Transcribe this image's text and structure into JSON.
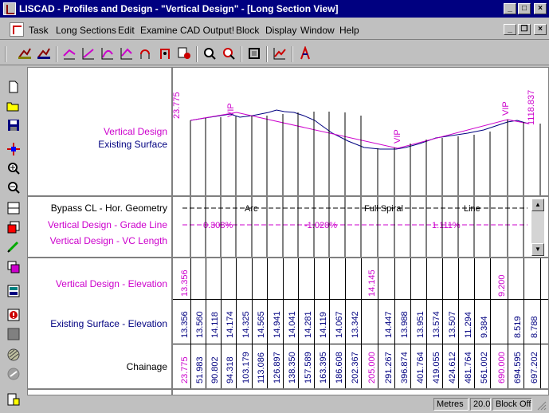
{
  "window": {
    "title": "LISCAD - Profiles and Design - \"Vertical Design\" - [Long Section View]"
  },
  "window_buttons": {
    "minimize": "_",
    "maximize": "□",
    "close": "×"
  },
  "mdi_buttons": {
    "minimize": "_",
    "restore": "❐",
    "close": "×"
  },
  "menu": [
    "Task",
    "Long Sections",
    "Edit",
    "Examine",
    "CAD Output!",
    "Block",
    "Display",
    "Window",
    "Help"
  ],
  "toolbar_icons": [
    "open-section-icon",
    "import-section-icon",
    "edit-design-icon",
    "grade-line-icon",
    "vertical-curve-icon",
    "intersection-icon",
    "design-check-icon",
    "attach-icon",
    "zoom-window-icon",
    "zoom-extents-icon",
    "frame-icon",
    "graph-icon",
    "report-icon"
  ],
  "left_toolbar_icons": [
    "new-file-icon",
    "open-folder-icon",
    "save-icon",
    "move-cross-icon",
    "zoom-in-icon",
    "zoom-out-icon",
    "split-view-icon",
    "color-icon",
    "pencil-icon",
    "copy-icon",
    "calculator-icon",
    "alert-icon",
    "block-icon",
    "hatch-icon",
    "disabled-tool-icon",
    "properties-icon"
  ],
  "labels": {
    "vertical_design": "Vertical Design",
    "existing_surface": "Existing Surface",
    "bypass": "Bypass CL - Hor. Geometry",
    "grade_line": "Vertical Design - Grade Line",
    "vc_length": "Vertical Design - VC Length",
    "vd_elevation": "Vertical Design - Elevation",
    "es_elevation": "Existing Surface - Elevation",
    "chainage": "Chainage"
  },
  "profile": {
    "start_chainage": "23.775",
    "end_chainage": "1118.837",
    "vip_label": "VIP"
  },
  "geometry": {
    "arc": "Arc",
    "full_spiral": "Full Spiral",
    "line": "Line",
    "grade1": "0.308%",
    "grade2": "-1.020%",
    "grade3": "1.111%"
  },
  "vd_elevations": [
    {
      "value": "13.356",
      "color": "#cc00cc"
    },
    {
      "value": "14.145",
      "color": "#cc00cc"
    },
    {
      "value": "9.200",
      "color": "#cc00cc"
    }
  ],
  "es_elevations": [
    "13.356",
    "13.560",
    "14.118",
    "14.174",
    "14.325",
    "14.565",
    "14.941",
    "14.041",
    "14.281",
    "14.119",
    "14.067",
    "13.342",
    "14.447",
    "13.988",
    "13.951",
    "13.574",
    "13.507",
    "11.294",
    "9.384",
    "8.519",
    "8.788"
  ],
  "chainages": [
    {
      "value": "23.775",
      "color": "#cc00cc"
    },
    {
      "value": "51.983",
      "color": "#000080"
    },
    {
      "value": "90.802",
      "color": "#000080"
    },
    {
      "value": "94.318",
      "color": "#000080"
    },
    {
      "value": "103.179",
      "color": "#000080"
    },
    {
      "value": "113.086",
      "color": "#000080"
    },
    {
      "value": "126.897",
      "color": "#000080"
    },
    {
      "value": "138.350",
      "color": "#000080"
    },
    {
      "value": "157.589",
      "color": "#000080"
    },
    {
      "value": "163.395",
      "color": "#000080"
    },
    {
      "value": "186.608",
      "color": "#000080"
    },
    {
      "value": "202.367",
      "color": "#000080"
    },
    {
      "value": "205.000",
      "color": "#cc00cc"
    },
    {
      "value": "291.267",
      "color": "#000080"
    },
    {
      "value": "396.874",
      "color": "#000080"
    },
    {
      "value": "401.764",
      "color": "#000080"
    },
    {
      "value": "419.055",
      "color": "#000080"
    },
    {
      "value": "424.612",
      "color": "#000080"
    },
    {
      "value": "481.764",
      "color": "#000080"
    },
    {
      "value": "561.002",
      "color": "#000080"
    },
    {
      "value": "690.000",
      "color": "#cc00cc"
    },
    {
      "value": "694.595",
      "color": "#000080"
    },
    {
      "value": "697.202",
      "color": "#000080"
    }
  ],
  "status": {
    "units": "Metres",
    "scale": "20.0",
    "block": "Block Off"
  },
  "colors": {
    "design": "#cc00cc",
    "surface": "#000080",
    "titlebar": "#000080"
  }
}
